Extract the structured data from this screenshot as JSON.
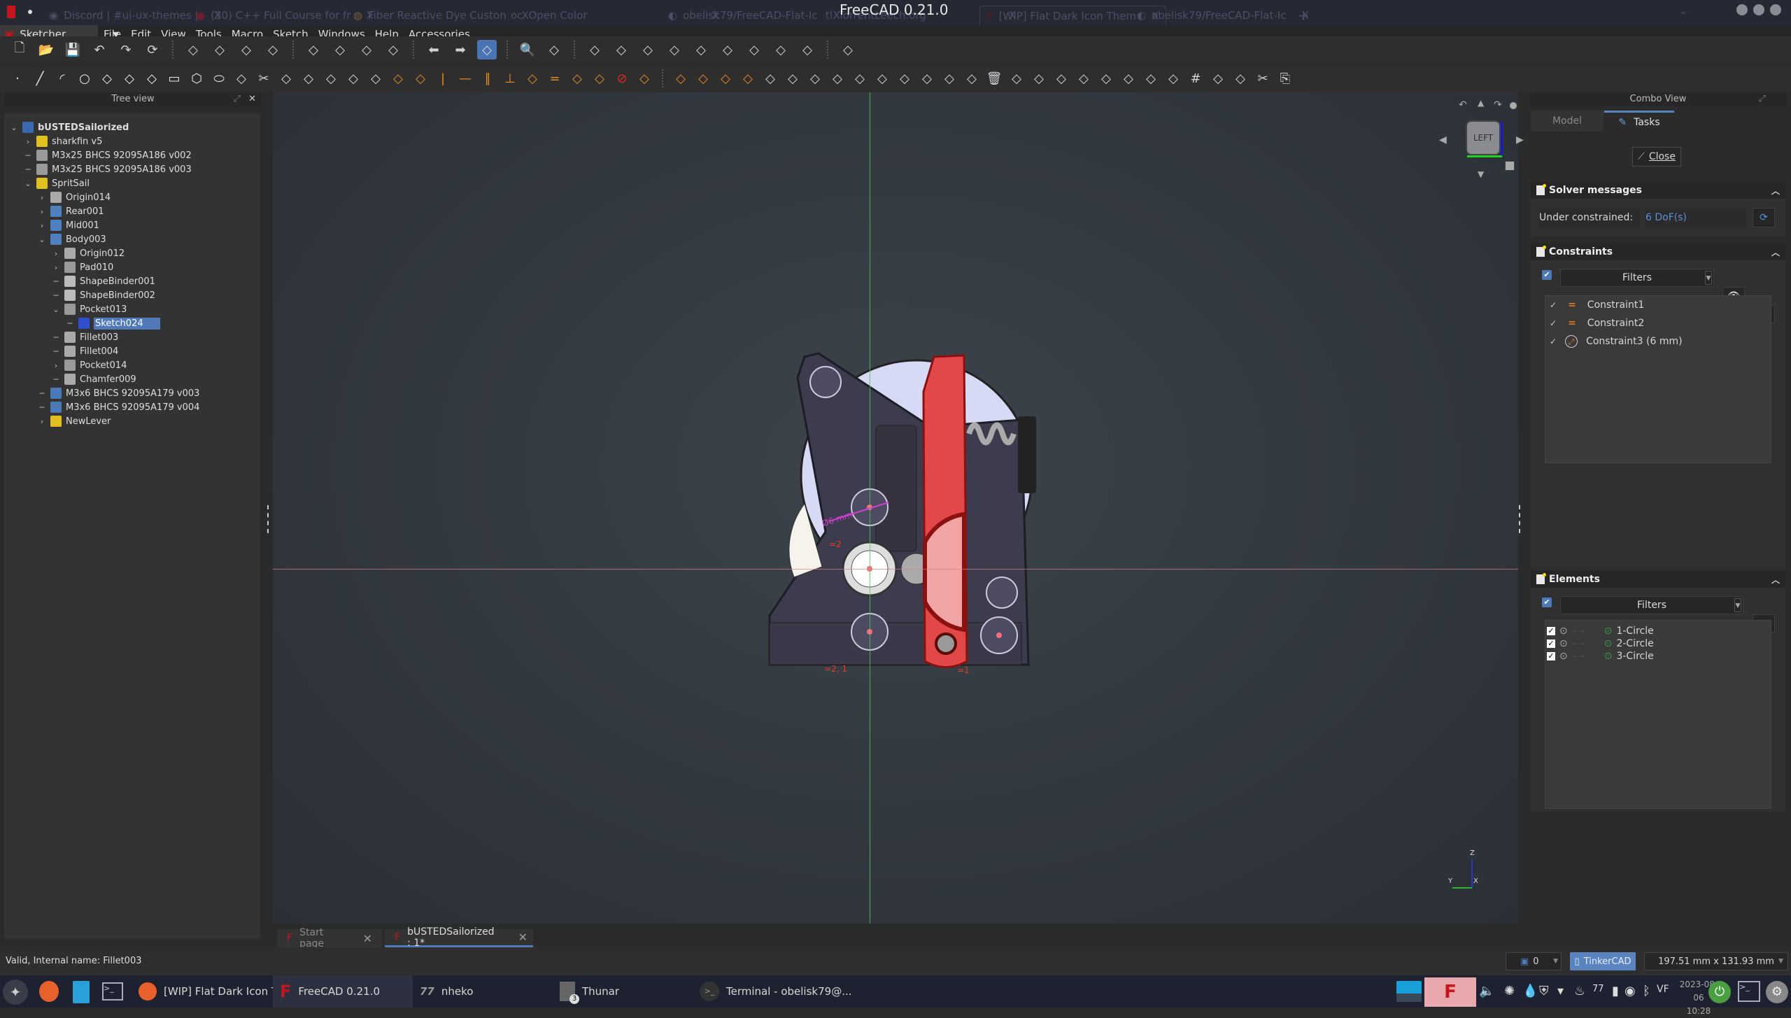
{
  "titlebar": {
    "window_title": "FreeCAD 0.21.0",
    "browser_tabs": [
      {
        "label": "Discord | #ui-ux-themes |",
        "icon": "discord-icon"
      },
      {
        "label": "(30) C++ Full Course for fr",
        "icon": "youtube-icon"
      },
      {
        "label": "Fiber Reactive Dye Custon",
        "icon": "colorwheel-icon"
      },
      {
        "label": "Open Color",
        "icon": "opencolor-icon"
      },
      {
        "label": "obelisk79/FreeCAD-Flat-Ic",
        "icon": "github-icon"
      },
      {
        "label": "TorrentLeech.org",
        "icon": "torrentleech-icon"
      },
      {
        "label": "[WIP] Flat Dark Icon Them",
        "icon": "freecad-icon"
      },
      {
        "label": "obelisk79/FreeCAD-Flat-Ic",
        "icon": "github-icon"
      }
    ],
    "close_glyph": "X",
    "new_tab_glyph": "+"
  },
  "menubar": {
    "workbench": "Sketcher",
    "items": [
      "File",
      "Edit",
      "View",
      "Tools",
      "Macro",
      "Sketch",
      "Windows",
      "Help",
      "Accessories"
    ]
  },
  "toolbar1": [
    "new-file",
    "open-file",
    "save-file",
    "undo",
    "redo",
    "refresh",
    "macro-record",
    "macro-stop",
    "macro-edit",
    "macro-execute",
    "fit-all",
    "fit-selection",
    "draw-style",
    "bounding-box",
    "back",
    "forward",
    "sync-view",
    "std-zoom",
    "isometric",
    "front-view",
    "top-view",
    "right-view",
    "rear-view",
    "bottom-view",
    "left-view",
    "measure",
    "toggle-selection",
    "toggle-navigation",
    "view-3d"
  ],
  "toolbar2_left": [
    "point",
    "line",
    "arc",
    "circle",
    "conic",
    "bspline",
    "polyline",
    "rectangle",
    "polygon",
    "slot",
    "fillet",
    "trim",
    "extend",
    "split",
    "external-geometry",
    "carbon-copy",
    "toggle-construction",
    "constrain-coincident",
    "constrain-point-on-object",
    "constrain-vertical",
    "constrain-horizontal",
    "constrain-parallel",
    "constrain-perpendicular",
    "constrain-tangent",
    "constrain-equal",
    "constrain-symmetric",
    "constrain-block",
    "constrain-lock",
    "constrain-horizontal-distance"
  ],
  "toolbar2_right": [
    "constrain-vertical-distance",
    "constrain-distance",
    "constrain-radius",
    "constrain-angle",
    "toggle-driving",
    "switch-virtual-space",
    "show-hide-geometry",
    "select-conflicting",
    "select-redundant",
    "select-origin",
    "select-h-axis",
    "select-v-axis",
    "restore-internal",
    "symmetry",
    "delete-all",
    "select-elements",
    "validate-sketch",
    "clone",
    "copy",
    "move",
    "rectangular-array",
    "remove-axes-alignment",
    "show-all-geometry",
    "grid",
    "snap",
    "render-order",
    "cut",
    "paste"
  ],
  "tree": {
    "title": "Tree view",
    "items": [
      {
        "label": "bUSTEDSailorized",
        "depth": 0,
        "arrow": "down",
        "icon": "document-icon"
      },
      {
        "label": "sharkfin v5",
        "depth": 1,
        "arrow": "right",
        "icon": "part-icon"
      },
      {
        "label": "M3x25 BHCS 92095A186 v002",
        "depth": 1,
        "arrow": "",
        "icon": "solid-icon"
      },
      {
        "label": "M3x25 BHCS 92095A186 v003",
        "depth": 1,
        "arrow": "",
        "icon": "solid-icon"
      },
      {
        "label": "SpritSail",
        "depth": 1,
        "arrow": "down",
        "icon": "part-icon"
      },
      {
        "label": "Origin014",
        "depth": 2,
        "arrow": "right",
        "icon": "origin-icon"
      },
      {
        "label": "Rear001",
        "depth": 2,
        "arrow": "right",
        "icon": "body-icon"
      },
      {
        "label": "Mid001",
        "depth": 2,
        "arrow": "right",
        "icon": "body-icon"
      },
      {
        "label": "Body003",
        "depth": 2,
        "arrow": "down",
        "icon": "body-icon"
      },
      {
        "label": "Origin012",
        "depth": 3,
        "arrow": "right",
        "icon": "origin-icon"
      },
      {
        "label": "Pad010",
        "depth": 3,
        "arrow": "right",
        "icon": "pad-icon"
      },
      {
        "label": "ShapeBinder001",
        "depth": 3,
        "arrow": "",
        "icon": "shapebinder-icon"
      },
      {
        "label": "ShapeBinder002",
        "depth": 3,
        "arrow": "",
        "icon": "shapebinder-icon"
      },
      {
        "label": "Pocket013",
        "depth": 3,
        "arrow": "down",
        "icon": "pocket-icon"
      },
      {
        "label": "Sketch024",
        "depth": 4,
        "arrow": "",
        "icon": "sketch-icon",
        "selected": true
      },
      {
        "label": "Fillet003",
        "depth": 3,
        "arrow": "",
        "icon": "fillet-icon"
      },
      {
        "label": "Fillet004",
        "depth": 3,
        "arrow": "",
        "icon": "fillet-icon"
      },
      {
        "label": "Pocket014",
        "depth": 3,
        "arrow": "right",
        "icon": "pocket-icon"
      },
      {
        "label": "Chamfer009",
        "depth": 3,
        "arrow": "",
        "icon": "chamfer-icon"
      },
      {
        "label": "M3x6 BHCS 92095A179 v003",
        "depth": 2,
        "arrow": "",
        "icon": "solid-blue-icon"
      },
      {
        "label": "M3x6 BHCS 92095A179 v004",
        "depth": 2,
        "arrow": "",
        "icon": "solid-blue-icon"
      },
      {
        "label": "NewLever",
        "depth": 2,
        "arrow": "right",
        "icon": "part-icon"
      }
    ]
  },
  "viewport": {
    "navcube_face": "LEFT",
    "axis_labels": {
      "z": "Z",
      "y": "Y",
      "x": "X"
    },
    "sketch_annotations": {
      "diameter": "Ø6 mm",
      "equal_a": "=2",
      "equal_b": "=2, 1",
      "equal_c": "=1"
    }
  },
  "doc_tabs": [
    {
      "label": "Start page",
      "active": false
    },
    {
      "label": "bUSTEDSailorized : 1*",
      "active": true
    }
  ],
  "combo": {
    "title": "Combo View",
    "tabs": [
      {
        "label": "Model",
        "active": false
      },
      {
        "label": "Tasks",
        "active": true
      }
    ],
    "close_button": "Close",
    "solver": {
      "title": "Solver messages",
      "label": "Under constrained:",
      "value": "6 DoF(s)"
    },
    "constraints": {
      "title": "Constraints",
      "filter_label": "Filters",
      "items": [
        {
          "label": "Constraint1",
          "type": "equal"
        },
        {
          "label": "Constraint2",
          "type": "equal"
        },
        {
          "label": "Constraint3 (6 mm)",
          "type": "diameter"
        }
      ]
    },
    "elements": {
      "title": "Elements",
      "filter_label": "Filters",
      "items": [
        {
          "label": "1-Circle"
        },
        {
          "label": "2-Circle"
        },
        {
          "label": "3-Circle"
        }
      ]
    }
  },
  "status": {
    "message": "Valid, Internal name: Fillet003",
    "count": "0",
    "navigation_style": "TinkerCAD",
    "dimensions": "197.51 mm x 131.93 mm"
  },
  "taskbar": {
    "tasks": [
      {
        "label": "[WIP] Flat Dark Icon Th...",
        "icon": "firefox-icon"
      },
      {
        "label": "FreeCAD 0.21.0",
        "icon": "freecad-icon",
        "active": true
      },
      {
        "label": "nheko",
        "icon": "nheko-icon"
      },
      {
        "label": "Thunar",
        "icon": "thunar-icon",
        "badge": "3"
      },
      {
        "label": "Terminal - obelisk79@...",
        "icon": "terminal-icon"
      }
    ],
    "date": "2023-08-06",
    "time": "10:28"
  }
}
